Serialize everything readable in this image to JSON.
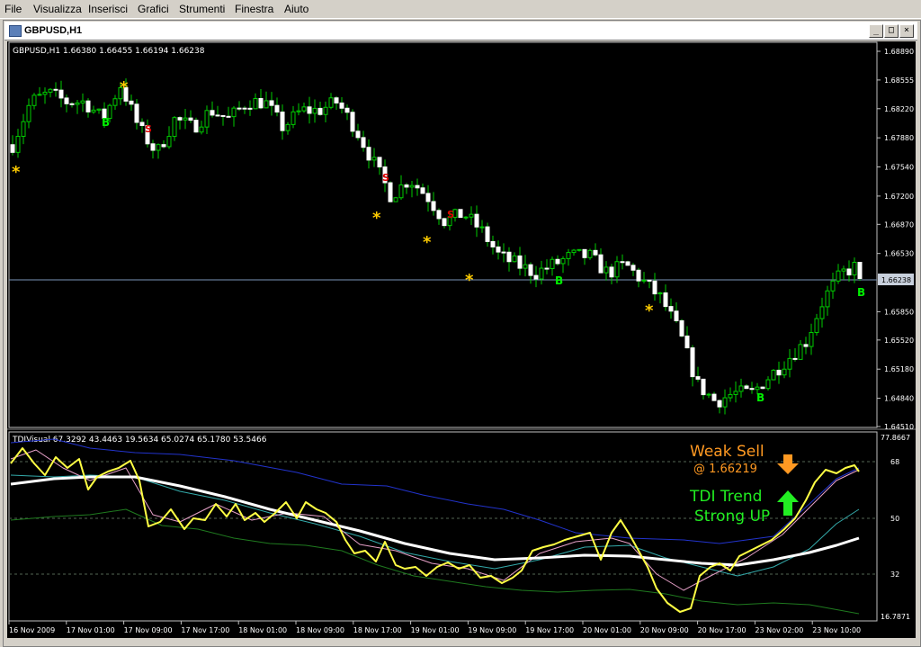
{
  "menu": [
    "File",
    "Visualizza",
    "Inserisci",
    "Grafici",
    "Strumenti",
    "Finestra",
    "Aiuto"
  ],
  "window": {
    "title": "GBPUSD,H1",
    "btn_min": "_",
    "btn_max": "□",
    "btn_close": "×"
  },
  "price_chart": {
    "header": "GBPUSD,H1  1.66380 1.66455 1.66194 1.66238",
    "yticks": [
      "1.68890",
      "1.68555",
      "1.68220",
      "1.67880",
      "1.67540",
      "1.67200",
      "1.66870",
      "1.66530",
      "1.66238",
      "1.65850",
      "1.65520",
      "1.65180",
      "1.64840",
      "1.64510"
    ],
    "current_price": "1.66238",
    "signal_s": "S",
    "signal_b": "B",
    "signal_star": "*",
    "colors": {
      "bull": "#ffffff",
      "bear": "#ffffff",
      "wick": "#00cc00",
      "star": "#ffcc00",
      "buy": "#00ee00",
      "sell": "#dd0000",
      "price_line": "#7a96b8"
    }
  },
  "tdi": {
    "header": "TDIVisual 67.3292 43.4463 19.5634 65.0274 65.1780 53.5466",
    "ytop": "77.8667",
    "ybottom": "16.7871",
    "levels": [
      "68",
      "50",
      "32"
    ],
    "weak_sell": "Weak Sell",
    "weak_sell_price": "@ 1.66219",
    "trend_line1": "TDI Trend",
    "trend_line2": "Strong UP",
    "colors": {
      "rsi": "#ffff44",
      "signal": "#ffffff",
      "upper": "#2233cc",
      "lower": "#1f7a1f",
      "mid": "#33aaaa",
      "fast": "#e6a0c8",
      "sell": "#ff9922",
      "up": "#22ee22"
    }
  },
  "xaxis": [
    "16 Nov 2009",
    "17 Nov 01:00",
    "17 Nov 09:00",
    "17 Nov 17:00",
    "18 Nov 01:00",
    "18 Nov 09:00",
    "18 Nov 17:00",
    "19 Nov 01:00",
    "19 Nov 09:00",
    "19 Nov 17:00",
    "20 Nov 01:00",
    "20 Nov 09:00",
    "20 Nov 17:00",
    "23 Nov 02:00",
    "23 Nov 10:00"
  ],
  "chart_data": {
    "type": "candlestick",
    "symbol": "GBPUSD",
    "timeframe": "H1",
    "close_trend": [
      1.678,
      1.683,
      1.684,
      1.683,
      1.683,
      1.681,
      1.685,
      1.68,
      1.677,
      1.681,
      1.68,
      1.682,
      1.681,
      1.683,
      1.683,
      1.68,
      1.682,
      1.682,
      1.683,
      1.68,
      1.676,
      1.672,
      1.674,
      1.672,
      1.669,
      1.67,
      1.668,
      1.665,
      1.664,
      1.663,
      1.664,
      1.665,
      1.665,
      1.663,
      1.664,
      1.662,
      1.66,
      1.656,
      1.65,
      1.648,
      1.649,
      1.649,
      1.651,
      1.653,
      1.655,
      1.66,
      1.663,
      1.664
    ],
    "last": {
      "open": 1.6638,
      "high": 1.66455,
      "low": 1.66194,
      "close": 1.66238
    }
  }
}
